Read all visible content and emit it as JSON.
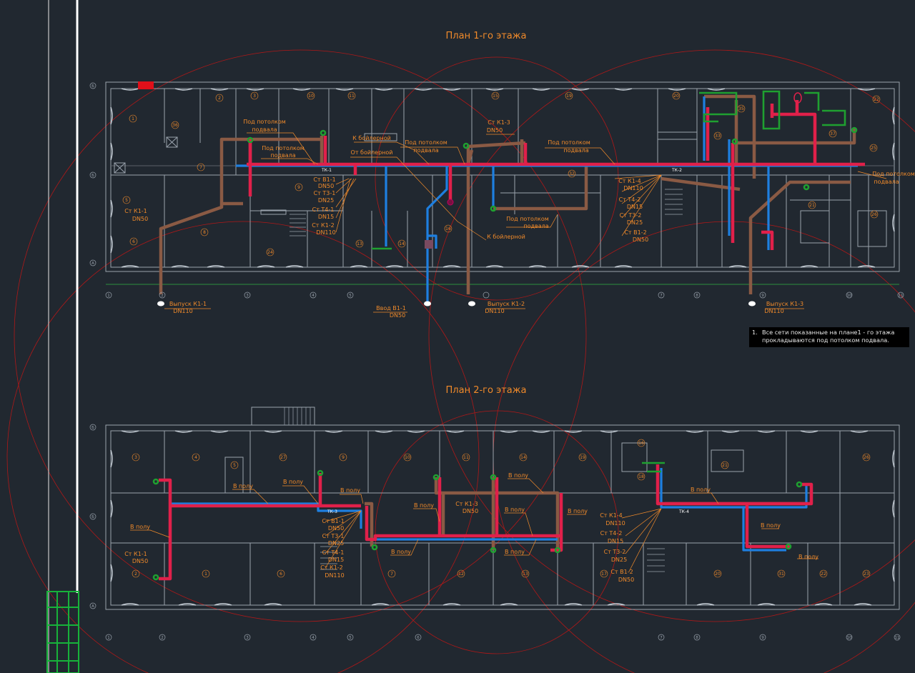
{
  "floor1": {
    "title": "План 1-го этажа",
    "room_numbers": [
      "1",
      "2",
      "3",
      "10",
      "11",
      "15",
      "19",
      "20",
      "22",
      "36",
      "7",
      "9",
      "24",
      "16",
      "13",
      "14",
      "32",
      "21",
      "25",
      "26",
      "33",
      "35",
      "37",
      "5",
      "6",
      "8"
    ],
    "labels": {
      "under_ceiling_a": "Под потолком",
      "under_ceiling_b": "подвала",
      "to_boiler": "К бойлерной",
      "from_boiler": "От бойлерной",
      "st_k1_1": "Ст К1-1",
      "st_k1_2": "Ст К1-2",
      "st_k1_3": "Ст К1-3",
      "st_k1_4": "Ст К1-4",
      "st_b1_1": "Ст В1-1",
      "st_b1_2": "Ст В1-2",
      "st_t3_1": "Ст Т3-1",
      "st_t3_2": "Ст Т3-2",
      "st_t4_1": "Ст Т4-1",
      "st_t4_2": "Ст Т4-2",
      "dn50": "DN50",
      "dn25": "DN25",
      "dn15": "DN15",
      "dn110": "DN110",
      "tk1": "ТК-1",
      "tk2": "ТК-2",
      "outlet_k1_1": "Выпуск К1-1",
      "outlet_k1_2": "Выпуск К1-2",
      "outlet_k1_3": "Выпуск К1-3",
      "inlet_b1_1": "Ввод В1-1"
    }
  },
  "floor2": {
    "title": "План 2-го этажа",
    "room_numbers": [
      "3",
      "4",
      "5",
      "27",
      "9",
      "10",
      "11",
      "14",
      "19",
      "16",
      "18",
      "21",
      "26",
      "2",
      "1",
      "6",
      "7",
      "12",
      "13",
      "17",
      "20",
      "31",
      "22",
      "23"
    ],
    "labels": {
      "in_floor": "В полу",
      "st_k1_1": "Ст К1-1",
      "st_k1_3": "Ст К1-3",
      "st_k1_4": "Ст К1-4",
      "st_b1_1": "Ст В1-1",
      "st_b1_2": "Ст В1-2",
      "st_t3_1": "Ст Т3-1",
      "st_t3_2": "Ст Т3-2",
      "st_t4_1": "Ст Т4-1",
      "st_t4_2": "Ст Т4-2",
      "st_k1_2": "Ст К1-2",
      "dn50": "DN50",
      "dn25": "DN25",
      "dn15": "DN15",
      "dn110": "DN110",
      "tk3": "ТК-3",
      "tk4": "ТК-4"
    }
  },
  "note": {
    "number": "1.",
    "line1": "Все сети показанные на плане1 - го этажа",
    "line2": "прокладываются под потолком подвала."
  },
  "axes": {
    "letters": [
      "Б",
      "Б",
      "А"
    ],
    "numbers": [
      "1",
      "2",
      "3",
      "4",
      "5",
      "6",
      "7",
      "8",
      "9",
      "10",
      "11"
    ]
  },
  "colors": {
    "background": "#212830",
    "pipe_k": "#8a5a44",
    "pipe_b": "#1e7fe0",
    "pipe_t": "#e0204a",
    "pipe_green": "#1fa030",
    "label_orange": "#f08a2a",
    "walls": "#9aa3ad",
    "circles": "#b01818"
  }
}
